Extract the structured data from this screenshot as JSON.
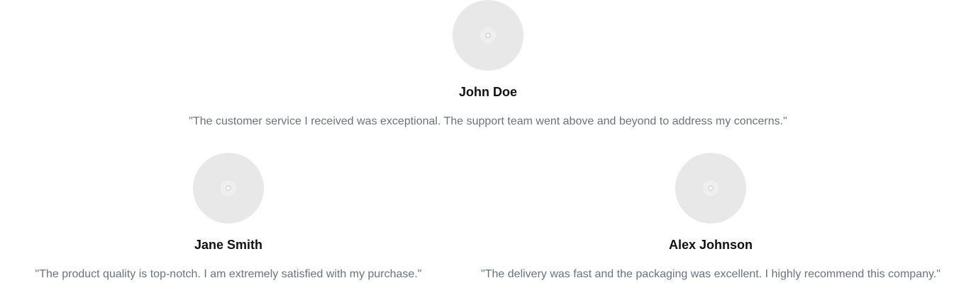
{
  "testimonials": [
    {
      "name": "John Doe",
      "quote": "\"The customer service I received was exceptional. The support team went above and beyond to address my concerns.\"",
      "avatar_icon": "image-placeholder-icon"
    },
    {
      "name": "Jane Smith",
      "quote": "\"The product quality is top-notch. I am extremely satisfied with my purchase.\"",
      "avatar_icon": "image-placeholder-icon"
    },
    {
      "name": "Alex Johnson",
      "quote": "\"The delivery was fast and the packaging was excellent. I highly recommend this company.\"",
      "avatar_icon": "image-placeholder-icon"
    }
  ],
  "colors": {
    "avatar_bg": "#e8e8e8",
    "name_text": "#111111",
    "quote_text": "#6b7280"
  }
}
